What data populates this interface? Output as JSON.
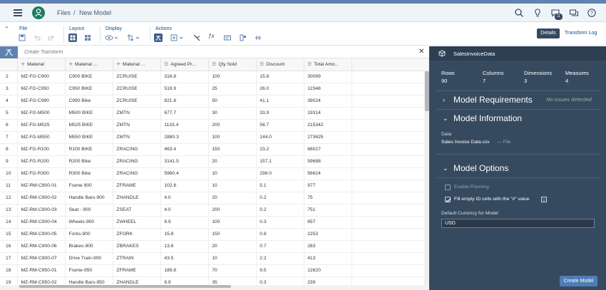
{
  "shell": {
    "breadcrumb_root": "Files",
    "breadcrumb_sep": "/",
    "breadcrumb_current": "New Model",
    "notification_count": "11"
  },
  "toolbar": {
    "file_label": "File",
    "layout_label": "Layout",
    "display_label": "Display",
    "actions_label": "Actions",
    "details_label": "Details",
    "transform_log_label": "Transform Log"
  },
  "transform": {
    "placeholder": "Create Transform"
  },
  "grid": {
    "columns": [
      "Material",
      "Material ...",
      "Material ...",
      "Agreed Pr...",
      "Qty Sold",
      "Discount",
      "Total Amo..."
    ],
    "rows": [
      [
        "2",
        "MZ-FG-C900",
        "C900 BIKE",
        "ZCRUISE",
        "316.8",
        "100",
        "15.8",
        "30099"
      ],
      [
        "3",
        "MZ-FG-C950",
        "C950 BIKE",
        "ZCRUISE",
        "519.9",
        "25",
        "26.0",
        "12348"
      ],
      [
        "4",
        "MZ-FG-C990",
        "C990 Bike",
        "ZCRUISE",
        "821.6",
        "50",
        "41.1",
        "39024"
      ],
      [
        "5",
        "MZ-FG-M500",
        "M500 BIKE",
        "ZMTN",
        "677.7",
        "30",
        "33.9",
        "19314"
      ],
      [
        "6",
        "MZ-FG-M525",
        "M525 BIKE",
        "ZMTN",
        "1133.4",
        "200",
        "56.7",
        "215342"
      ],
      [
        "7",
        "MZ-FG-M550",
        "M550 BIKE",
        "ZMTN",
        "2880.3",
        "100",
        "144.0",
        "273625"
      ],
      [
        "8",
        "MZ-FG-R100",
        "R100 BIKE",
        "ZRACING",
        "463.4",
        "150",
        "23.2",
        "66027"
      ],
      [
        "9",
        "MZ-FG-R200",
        "R200 Bike",
        "ZRACING",
        "3141.5",
        "20",
        "157.1",
        "59688"
      ],
      [
        "10",
        "MZ-FG-R300",
        "R300 Bike",
        "ZRACING",
        "5960.4",
        "10",
        "298.0",
        "56624"
      ],
      [
        "11",
        "MZ-RM-C900-01",
        "Frame 900",
        "ZFRAME",
        "102.8",
        "10",
        "5.1",
        "977"
      ],
      [
        "12",
        "MZ-RM-C900-02",
        "Handle Bars-900",
        "ZHANDLE",
        "4.0",
        "20",
        "0.2",
        "75"
      ],
      [
        "13",
        "MZ-RM-C900-03",
        "Seat - 900",
        "ZSEAT",
        "4.0",
        "200",
        "0.2",
        "751"
      ],
      [
        "14",
        "MZ-RM-C900-04",
        "Wheels-900",
        "ZWHEEL",
        "6.9",
        "100",
        "0.3",
        "657"
      ],
      [
        "15",
        "MZ-RM-C900-05",
        "Forks-900",
        "ZFORK",
        "15.8",
        "150",
        "0.8",
        "2253"
      ],
      [
        "16",
        "MZ-RM-C900-06",
        "Brakes-900",
        "ZBRAKES",
        "13.8",
        "20",
        "0.7",
        "263"
      ],
      [
        "17",
        "MZ-RM-C900-07",
        "Drive Train-900",
        "ZTRAIN",
        "43.5",
        "10",
        "2.2",
        "413"
      ],
      [
        "18",
        "MZ-RM-C950-01",
        "Frame-950",
        "ZFRAME",
        "189.8",
        "70",
        "9.5",
        "12620"
      ],
      [
        "19",
        "MZ-RM-C950-02",
        "Handle Bars-950",
        "ZHANDLE",
        "6.9",
        "35",
        "0.3",
        "239"
      ]
    ]
  },
  "panel": {
    "title": "SalesInvoiceData",
    "stats": [
      {
        "label": "Rows",
        "value": "90"
      },
      {
        "label": "Columns",
        "value": "7"
      },
      {
        "label": "Dimensions",
        "value": "3"
      },
      {
        "label": "Measures",
        "value": "4"
      }
    ],
    "requirements_title": "Model Requirements",
    "requirements_status": "No issues detected",
    "information_title": "Model Information",
    "data_label": "Data",
    "data_file": "Sales Invoice Data.csv",
    "data_type": "— File",
    "options_title": "Model Options",
    "enable_planning": "Enable Planning",
    "fill_empty": "Fill empty ID cells with the \"#\" value",
    "currency_label": "Default Currency for Model",
    "currency_value": "USD",
    "create_button": "Create Model"
  },
  "colors": {
    "shell_bg": "#eff4f9",
    "panel_bg": "#354a5f",
    "accent": "#5f83b0",
    "create_button": "#4f7cb5"
  }
}
